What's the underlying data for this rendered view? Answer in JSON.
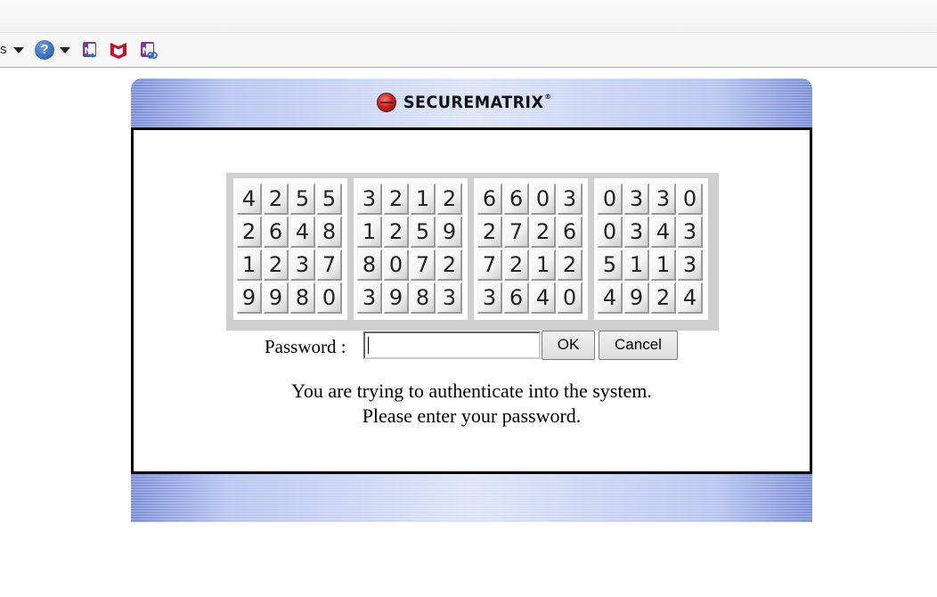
{
  "toolbar": {
    "partial_label": "s",
    "help_icon_glyph": "?",
    "icons": [
      "onenote-send-icon",
      "mcafee-icon",
      "onenote-linked-icon"
    ]
  },
  "window": {
    "brand": "SECUREMATRIX",
    "brand_mark": "®",
    "colors": {
      "frame_blue": "#9fb0ea",
      "border": "#000000"
    }
  },
  "matrix": {
    "blocks": [
      [
        [
          "4",
          "2",
          "5",
          "5"
        ],
        [
          "2",
          "6",
          "4",
          "8"
        ],
        [
          "1",
          "2",
          "3",
          "7"
        ],
        [
          "9",
          "9",
          "8",
          "0"
        ]
      ],
      [
        [
          "3",
          "2",
          "1",
          "2"
        ],
        [
          "1",
          "2",
          "5",
          "9"
        ],
        [
          "8",
          "0",
          "7",
          "2"
        ],
        [
          "3",
          "9",
          "8",
          "3"
        ]
      ],
      [
        [
          "6",
          "6",
          "0",
          "3"
        ],
        [
          "2",
          "7",
          "2",
          "6"
        ],
        [
          "7",
          "2",
          "1",
          "2"
        ],
        [
          "3",
          "6",
          "4",
          "0"
        ]
      ],
      [
        [
          "0",
          "3",
          "3",
          "0"
        ],
        [
          "0",
          "3",
          "4",
          "3"
        ],
        [
          "5",
          "1",
          "1",
          "3"
        ],
        [
          "4",
          "9",
          "2",
          "4"
        ]
      ]
    ]
  },
  "form": {
    "password_label": "Password :",
    "password_value": "",
    "ok_label": "OK",
    "cancel_label": "Cancel"
  },
  "message": {
    "line1": "You are trying to authenticate into the system.",
    "line2": "Please enter your password."
  }
}
